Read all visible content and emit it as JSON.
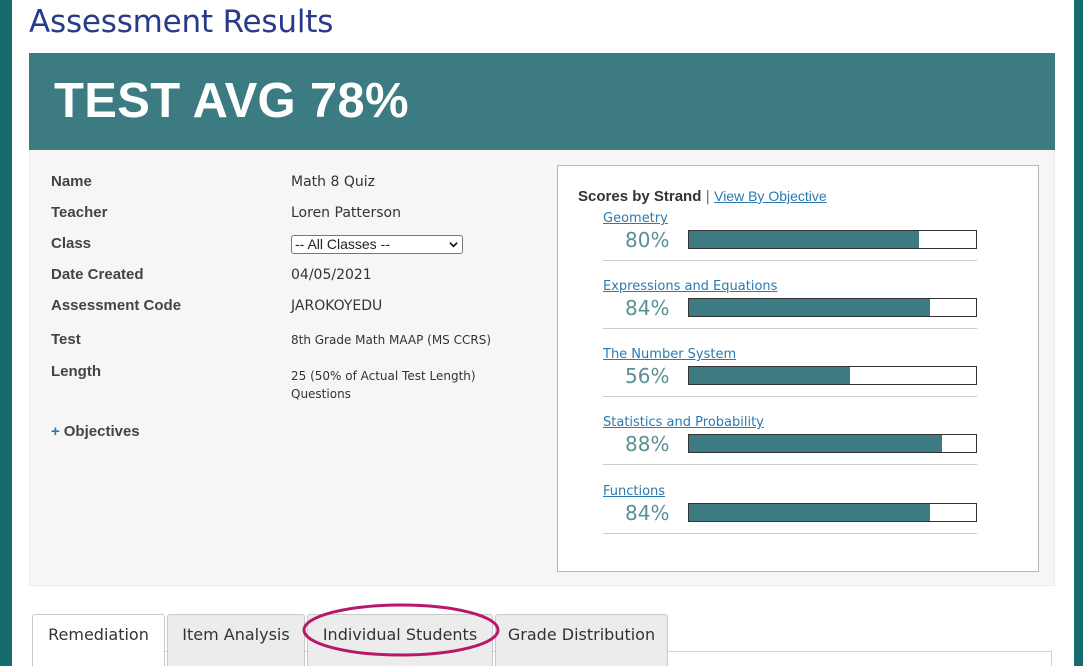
{
  "page": {
    "title": "Assessment Results"
  },
  "banner": {
    "text": "TEST AVG 78%"
  },
  "details": [
    {
      "label": "Name",
      "value": "Math 8 Quiz"
    },
    {
      "label": "Teacher",
      "value": "Loren Patterson"
    },
    {
      "label": "Class",
      "value": "-- All Classes --"
    },
    {
      "label": "Date Created",
      "value": "04/05/2021"
    },
    {
      "label": "Assessment Code",
      "value": "JAROKOYEDU"
    },
    {
      "label": "Test",
      "value": "8th Grade Math MAAP (MS CCRS)"
    },
    {
      "label": "Length",
      "value_line1": "25 (50% of Actual Test Length)",
      "value_line2": "Questions"
    }
  ],
  "objectives_toggle": {
    "plus": "+",
    "label": "Objectives"
  },
  "strands_panel": {
    "header": "Scores by Strand",
    "separator": "|",
    "view_link": "View By Objective",
    "strands": [
      {
        "name": "Geometry",
        "percent_text": "80%",
        "percent": 80
      },
      {
        "name": "Expressions and Equations",
        "percent_text": "84%",
        "percent": 84
      },
      {
        "name": "The Number System",
        "percent_text": "56%",
        "percent": 56
      },
      {
        "name": "Statistics and Probability",
        "percent_text": "88%",
        "percent": 88
      },
      {
        "name": "Functions",
        "percent_text": "84%",
        "percent": 84
      }
    ]
  },
  "tabs": [
    {
      "label": "Remediation",
      "active": true
    },
    {
      "label": "Item Analysis",
      "active": false
    },
    {
      "label": "Individual Students",
      "active": false,
      "highlighted": true
    },
    {
      "label": "Grade Distribution",
      "active": false
    }
  ],
  "colors": {
    "accent_teal": "#3c7b82",
    "frame_teal": "#166b6c",
    "title_blue": "#2a3a8a",
    "link_blue": "#2a7ab0",
    "highlight_magenta": "#b8176b"
  },
  "icons": {
    "select_caret": "chevron-down-icon"
  }
}
